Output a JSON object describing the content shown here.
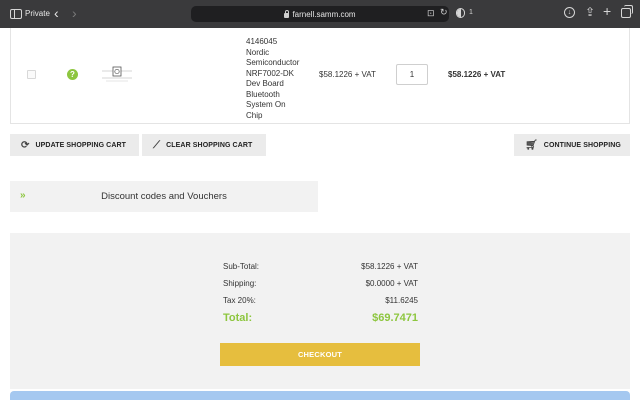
{
  "browser": {
    "private_label": "Private",
    "url": "farnell.samm.com",
    "shield_count": "1",
    "icons": [
      "sidebar-icon",
      "back-icon",
      "forward-icon",
      "lock-icon",
      "translate-icon",
      "refresh-icon",
      "shield-icon",
      "download-icon",
      "share-icon",
      "new-tab-icon",
      "tabs-overview-icon"
    ]
  },
  "cart": {
    "items": [
      {
        "description": "4146045\nNordic\nSemiconductor\nNRF7002-DK\nDev Board\nBluetooth\nSystem On\nChip",
        "unit_price": "$58.1226 + VAT",
        "quantity": "1",
        "total": "$58.1226 + VAT"
      }
    ]
  },
  "buttons": {
    "update": "UPDATE SHOPPING CART",
    "clear": "CLEAR SHOPPING CART",
    "continue": "CONTINUE SHOPPING"
  },
  "discount": {
    "arrow": "»",
    "label": "Discount codes and Vouchers"
  },
  "totals": {
    "subtotal_label": "Sub-Total:",
    "subtotal_value": "$58.1226 + VAT",
    "shipping_label": "Shipping:",
    "shipping_value": "$0.0000 + VAT",
    "tax_label": "Tax 20%:",
    "tax_value": "$11.6245",
    "total_label": "Total:",
    "total_value": "$69.7471",
    "checkout": "CHECKOUT"
  },
  "colors": {
    "accent_green": "#8dc63f",
    "checkout_yellow": "#e6be3e",
    "chrome": "#3a3a3c"
  }
}
